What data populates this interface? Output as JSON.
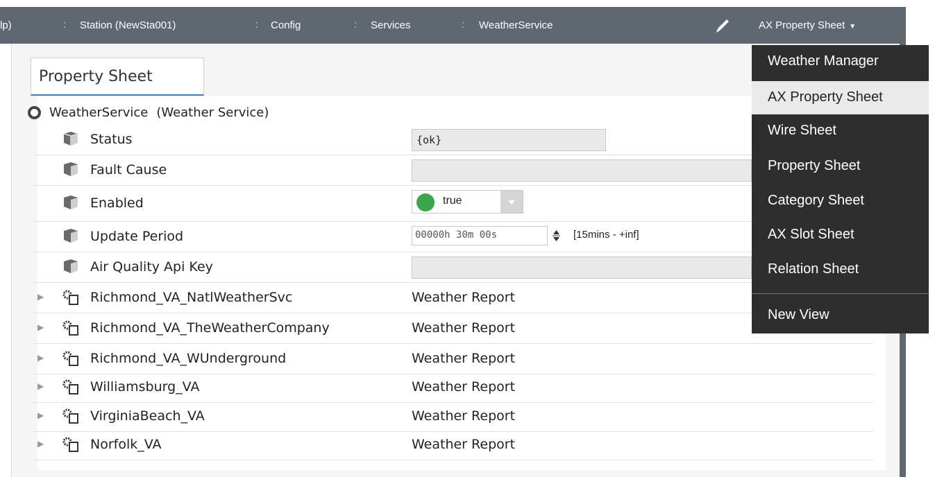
{
  "breadcrumbs": [
    {
      "label": "lp)"
    },
    {
      "label": "Station (NewSta001)"
    },
    {
      "label": "Config"
    },
    {
      "label": "Services"
    },
    {
      "label": "WeatherService"
    }
  ],
  "view_selector": {
    "label": "AX Property Sheet"
  },
  "tab": {
    "label": "Property Sheet"
  },
  "root": {
    "name": "WeatherService",
    "type": "(Weather Service)"
  },
  "properties": [
    {
      "name": "Status",
      "value": "{ok}"
    },
    {
      "name": "Fault Cause",
      "value": ""
    },
    {
      "name": "Enabled",
      "value": "true"
    },
    {
      "name": "Update Period",
      "value": "00000h 30m 00s",
      "range": "[15mins - +inf]"
    },
    {
      "name": "Air Quality Api Key",
      "value": ""
    }
  ],
  "children": [
    {
      "name": "Richmond_VA_NatlWeatherSvc",
      "type": "Weather Report"
    },
    {
      "name": "Richmond_VA_TheWeatherCompany",
      "type": "Weather Report"
    },
    {
      "name": "Richmond_VA_WUnderground",
      "type": "Weather Report"
    },
    {
      "name": "Williamsburg_VA",
      "type": "Weather Report"
    },
    {
      "name": "VirginiaBeach_VA",
      "type": "Weather Report"
    },
    {
      "name": "Norfolk_VA",
      "type": "Weather Report"
    }
  ],
  "menu": {
    "items": [
      {
        "label": "Weather Manager",
        "selected": false
      },
      {
        "label": "AX Property Sheet",
        "selected": true
      },
      {
        "label": "Wire Sheet",
        "selected": false
      },
      {
        "label": "Property Sheet",
        "selected": false
      },
      {
        "label": "Category Sheet",
        "selected": false
      },
      {
        "label": "AX Slot Sheet",
        "selected": false
      },
      {
        "label": "Relation Sheet",
        "selected": false
      }
    ],
    "new_view": "New View"
  },
  "colors": {
    "navbar": "#5f6770",
    "menu_bg": "#2e2e2e",
    "enabled_true": "#3aa54a",
    "tab_accent": "#3a7ec0"
  }
}
